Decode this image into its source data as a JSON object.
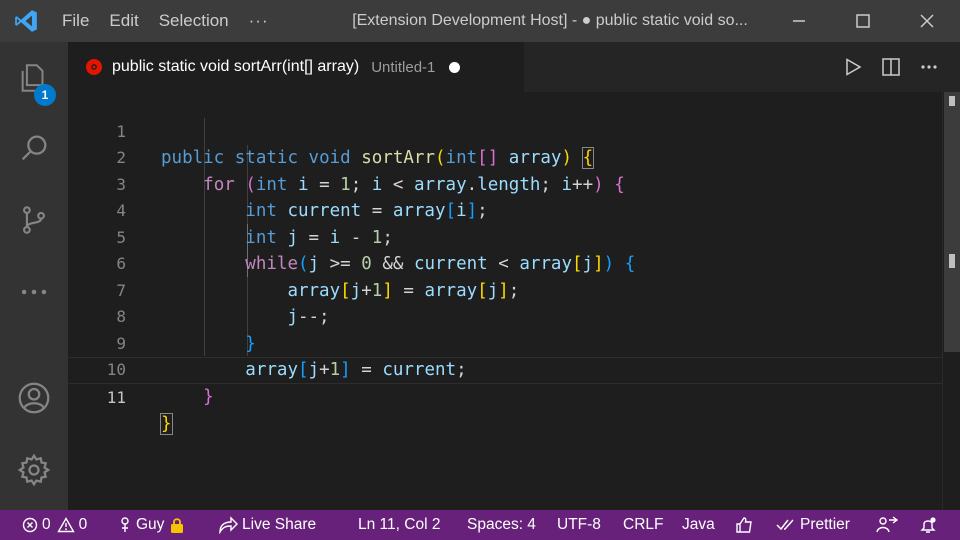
{
  "window": {
    "title": "[Extension Development Host] - ● public static void so...",
    "menu": [
      "File",
      "Edit",
      "Selection",
      "···"
    ]
  },
  "activity_bar": {
    "explorer_badge": "1"
  },
  "tab": {
    "title": "public static void sortArr(int[] array)",
    "description": "Untitled-1"
  },
  "editor": {
    "line_numbers": [
      "1",
      "2",
      "3",
      "4",
      "5",
      "6",
      "7",
      "8",
      "9",
      "10",
      "11"
    ],
    "current_line": 11,
    "lines": [
      "public static void sortArr(int[] array) {",
      "    for (int i = 1; i < array.length; i++) {",
      "        int current = array[i];",
      "        int j = i - 1;",
      "        while(j >= 0 && current < array[j]) {",
      "            array[j+1] = array[j];",
      "            j--;",
      "        }",
      "        array[j+1] = current;",
      "    }",
      "}"
    ]
  },
  "status_bar": {
    "errors": "0",
    "warnings": "0",
    "user": "Guy",
    "live_share": "Live Share",
    "cursor_position": "Ln 11, Col 2",
    "indentation": "Spaces: 4",
    "encoding": "UTF-8",
    "line_ending": "CRLF",
    "language": "Java",
    "formatter": "Prettier"
  },
  "colors": {
    "status_bar": "#68217a",
    "title_bar": "#3c3c3c",
    "activity_bar": "#333333",
    "editor_bg": "#1e1e1e",
    "accent_badge": "#007acc",
    "dirty_icon": "#e51400"
  }
}
